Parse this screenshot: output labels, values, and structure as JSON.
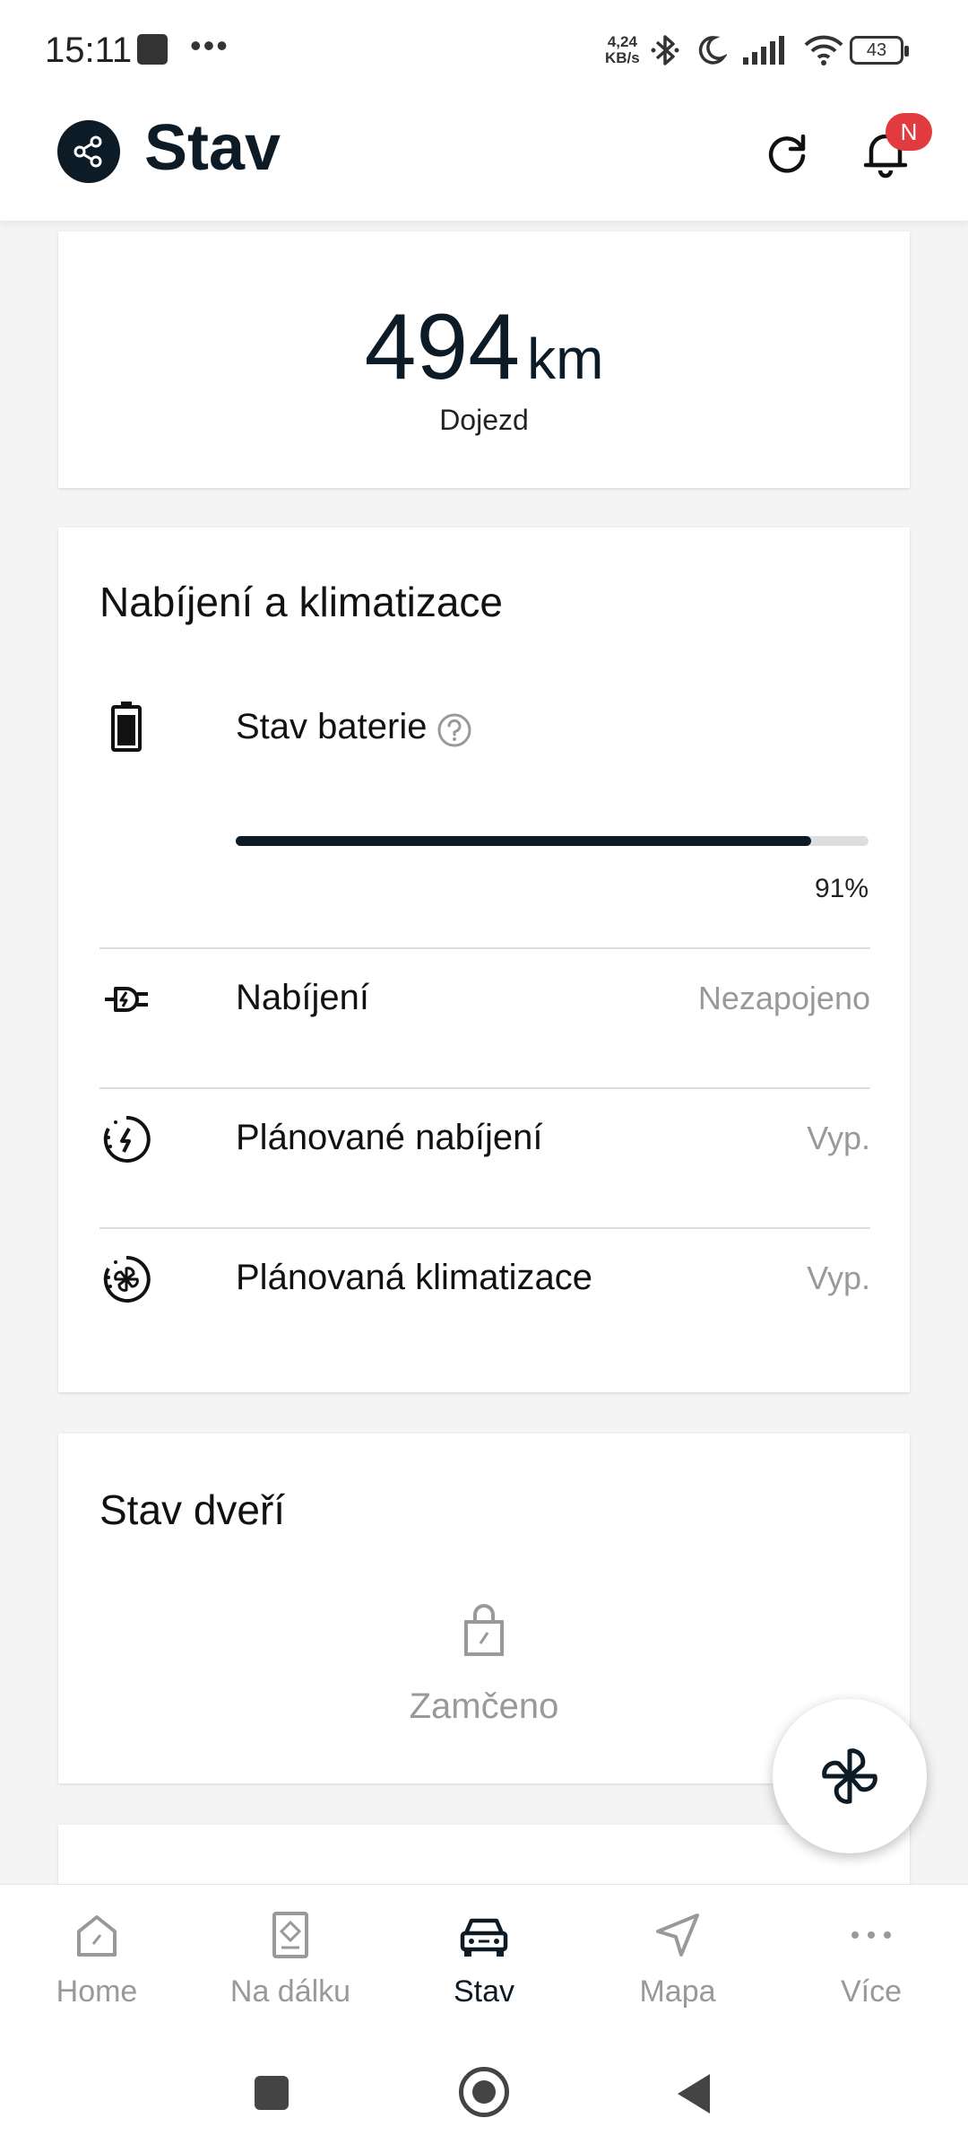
{
  "status_bar": {
    "time": "15:11",
    "net_speed_value": "4,24",
    "net_speed_unit": "KB/s",
    "battery_level": "43"
  },
  "app_bar": {
    "title": "Stav",
    "notification_badge": "N"
  },
  "range": {
    "value": "494",
    "unit": "km",
    "label": "Dojezd"
  },
  "charging": {
    "title": "Nabíjení a klimatizace",
    "battery_label": "Stav baterie",
    "battery_percent": 91,
    "battery_percent_text": "91%",
    "rows": [
      {
        "label": "Nabíjení",
        "value": "Nezapojeno"
      },
      {
        "label": "Plánované nabíjení",
        "value": "Vyp."
      },
      {
        "label": "Plánovaná klimatizace",
        "value": "Vyp."
      }
    ]
  },
  "doors": {
    "title": "Stav dveří",
    "status": "Zamčeno"
  },
  "bottom_nav": {
    "items": [
      {
        "label": "Home",
        "icon": "home-icon"
      },
      {
        "label": "Na dálku",
        "icon": "remote-icon"
      },
      {
        "label": "Stav",
        "icon": "car-icon"
      },
      {
        "label": "Mapa",
        "icon": "navigation-icon"
      },
      {
        "label": "Více",
        "icon": "more-icon"
      }
    ],
    "active": "Stav"
  },
  "colors": {
    "accent": "#0d1b26",
    "badge": "#e13a3f",
    "muted": "#999999"
  }
}
